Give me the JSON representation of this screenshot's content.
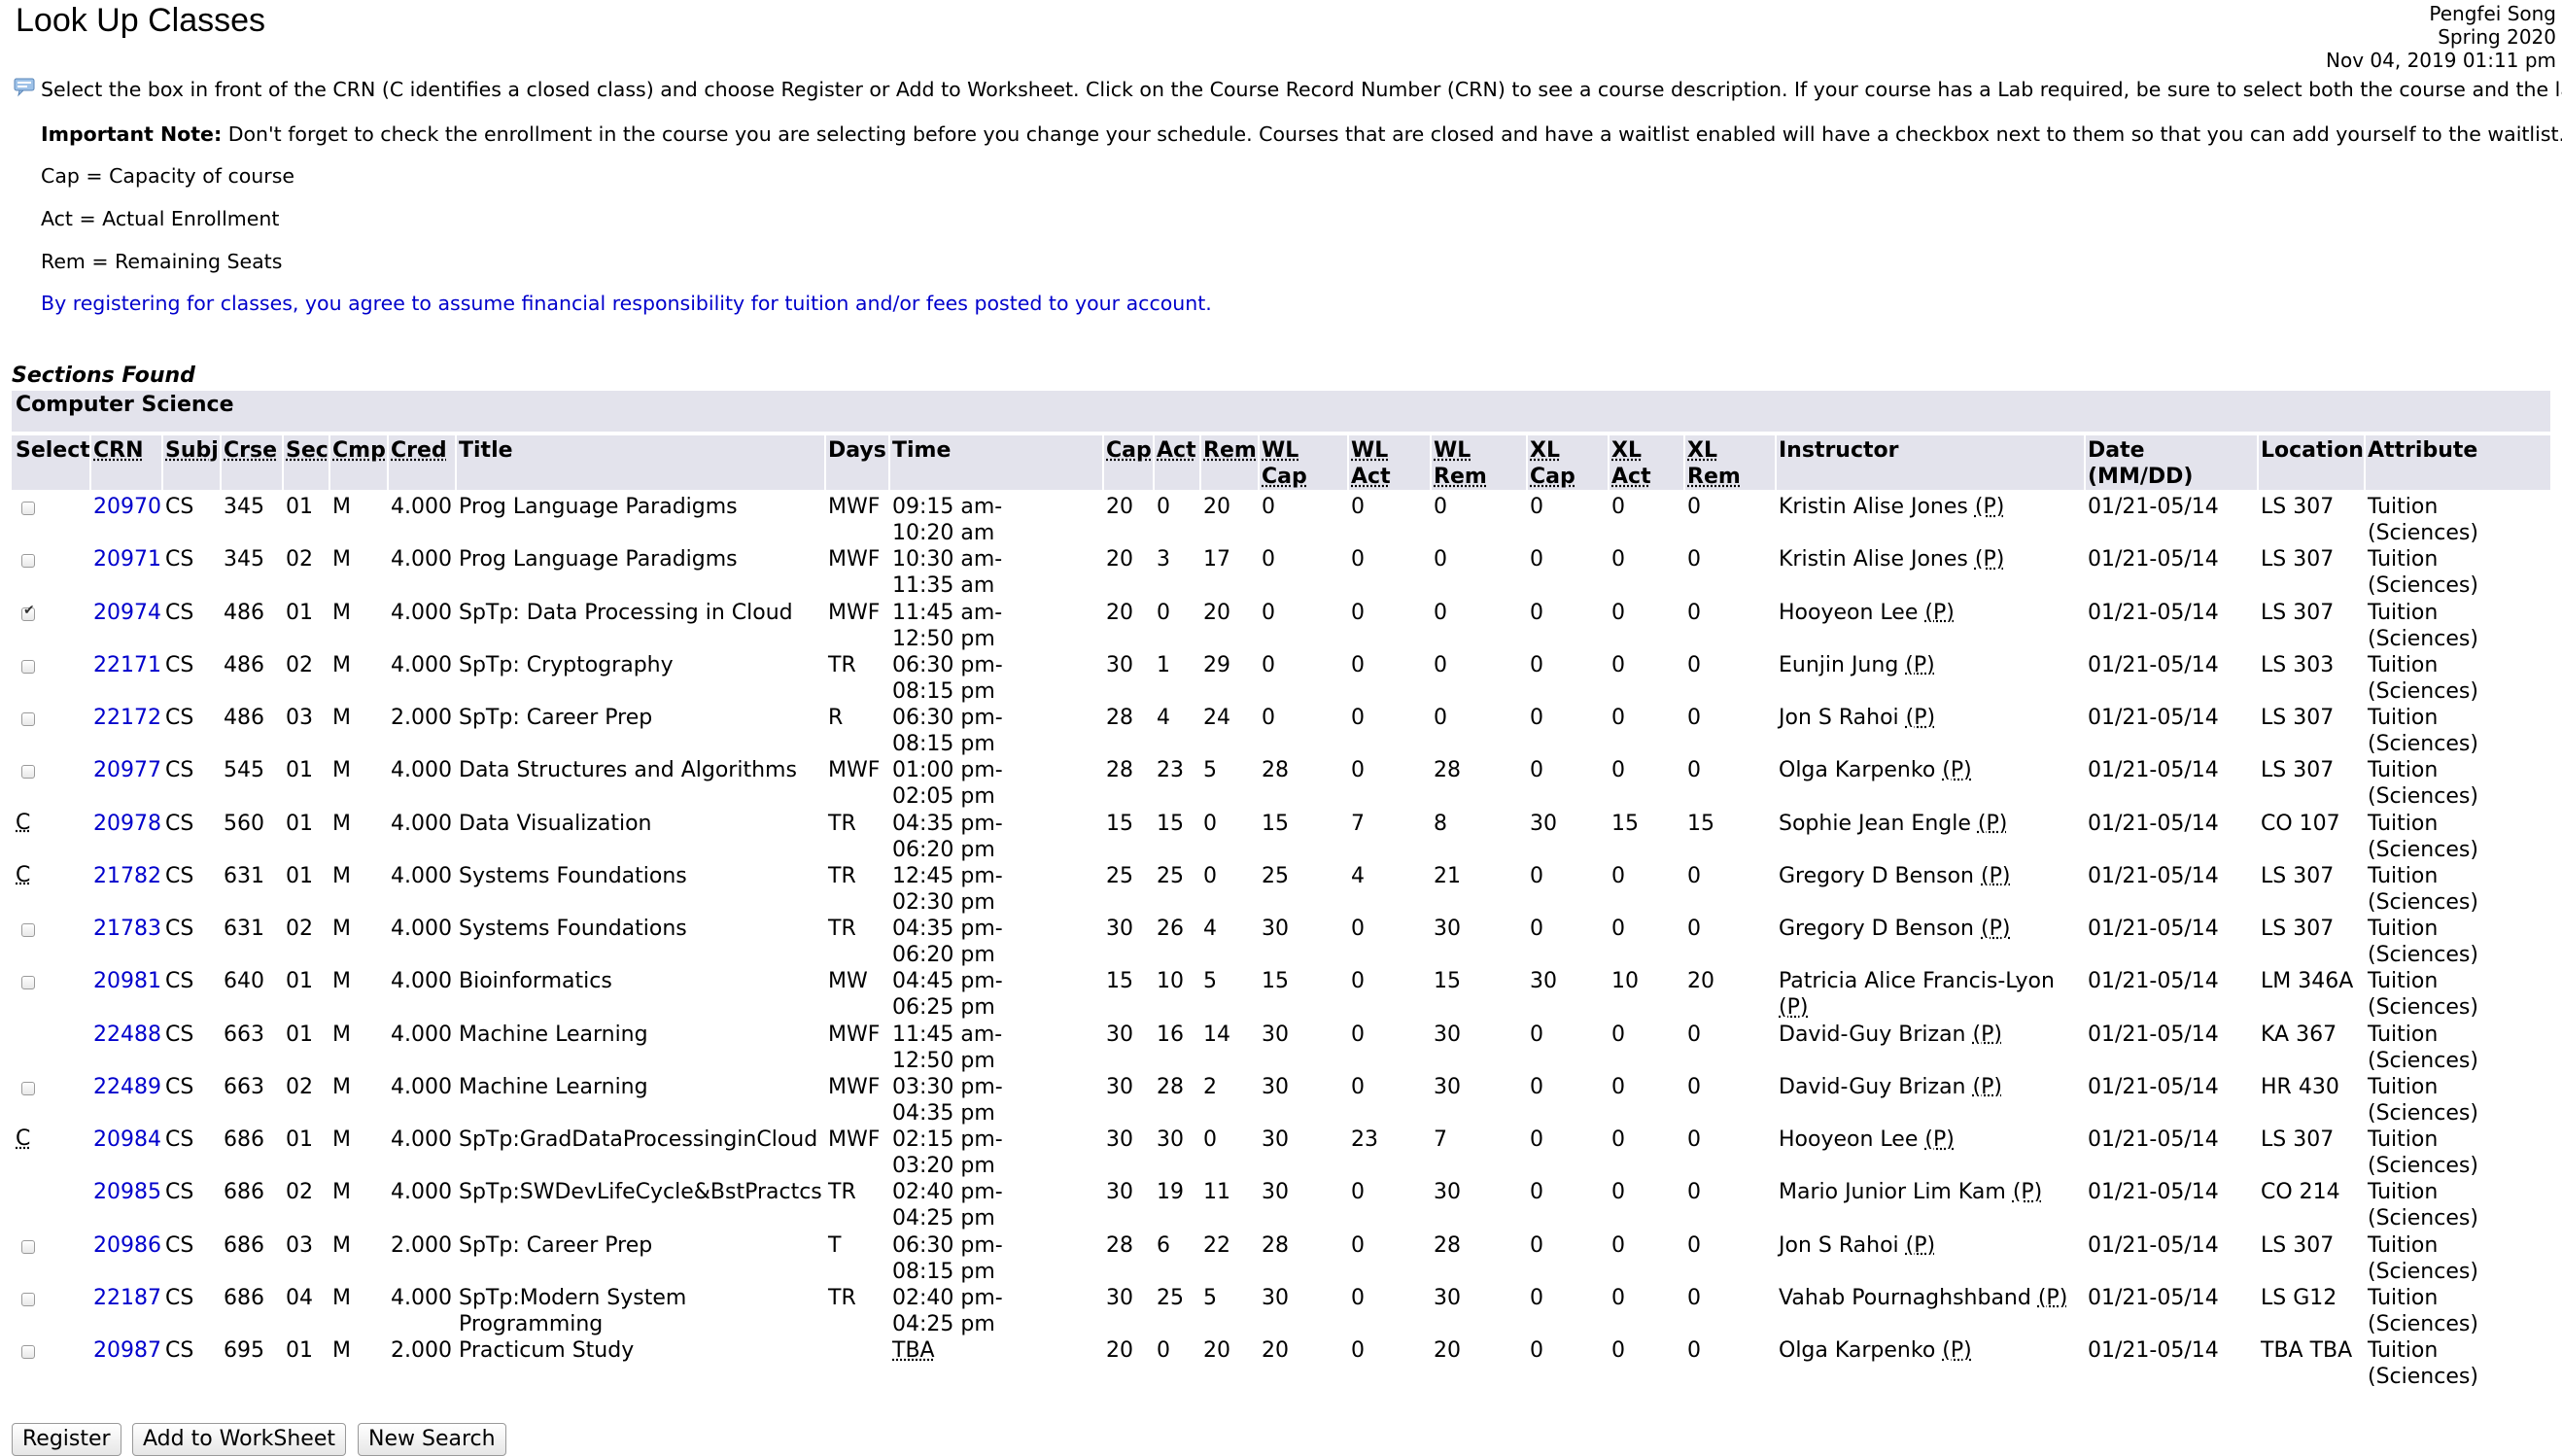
{
  "page": {
    "title": "Look Up Classes",
    "user": "Pengfei Song",
    "term": "Spring 2020",
    "datetime": "Nov 04, 2019 01:11 pm"
  },
  "notes": {
    "instructions": "Select the box in front of the CRN (C identifies a closed class) and choose Register or Add to Worksheet. Click on the Course Record Number (CRN) to see a course description. If your course has a Lab required, be sure to select both the course and the lab.",
    "important_label": "Important Note:",
    "important_text": " Don't forget to check the enrollment in the course you are selecting before you change your schedule. Courses that are closed and have a waitlist enabled will have a checkbox next to them so that you can add yourself to the waitlist.",
    "cap_def": "Cap = Capacity of course",
    "act_def": "Act = Actual Enrollment",
    "rem_def": "Rem = Remaining Seats",
    "financial": "By registering for classes, you agree to assume financial responsibility for tuition and/or fees posted to your account."
  },
  "sections_found": "Sections Found",
  "department": "Computer Science",
  "headers": {
    "select": "Select",
    "crn": "CRN",
    "subj": "Subj",
    "crse": "Crse",
    "sec": "Sec",
    "cmp": "Cmp",
    "cred": "Cred",
    "title": "Title",
    "days": "Days",
    "time": "Time",
    "cap": "Cap",
    "act": "Act",
    "rem": "Rem",
    "wl_cap": "WL\nCap",
    "wl_act": "WL\nAct",
    "wl_rem": "WL\nRem",
    "xl_cap": "XL\nCap",
    "xl_act": "XL\nAct",
    "xl_rem": "XL\nRem",
    "instructor": "Instructor",
    "date": "Date\n(MM/DD)",
    "location": "Location",
    "attribute": "Attribute"
  },
  "rows": [
    {
      "select": "box",
      "crn": "20970",
      "subj": "CS",
      "crse": "345",
      "sec": "01",
      "cmp": "M",
      "cred": "4.000",
      "title": "Prog Language Paradigms",
      "days": "MWF",
      "time": "09:15 am-10:20 am",
      "cap": "20",
      "act": "0",
      "rem": "20",
      "wl_cap": "0",
      "wl_act": "0",
      "wl_rem": "0",
      "xl_cap": "0",
      "xl_act": "0",
      "xl_rem": "0",
      "instructor": "Kristin Alise Jones",
      "date": "01/21-05/14",
      "location": "LS 307",
      "attribute": "Tuition (Sciences)"
    },
    {
      "select": "box",
      "crn": "20971",
      "subj": "CS",
      "crse": "345",
      "sec": "02",
      "cmp": "M",
      "cred": "4.000",
      "title": "Prog Language Paradigms",
      "days": "MWF",
      "time": "10:30 am-11:35 am",
      "cap": "20",
      "act": "3",
      "rem": "17",
      "wl_cap": "0",
      "wl_act": "0",
      "wl_rem": "0",
      "xl_cap": "0",
      "xl_act": "0",
      "xl_rem": "0",
      "instructor": "Kristin Alise Jones",
      "date": "01/21-05/14",
      "location": "LS 307",
      "attribute": "Tuition (Sciences)"
    },
    {
      "select": "checked",
      "crn": "20974",
      "subj": "CS",
      "crse": "486",
      "sec": "01",
      "cmp": "M",
      "cred": "4.000",
      "title": "SpTp: Data Processing in Cloud",
      "days": "MWF",
      "time": "11:45 am-12:50 pm",
      "cap": "20",
      "act": "0",
      "rem": "20",
      "wl_cap": "0",
      "wl_act": "0",
      "wl_rem": "0",
      "xl_cap": "0",
      "xl_act": "0",
      "xl_rem": "0",
      "instructor": "Hooyeon Lee",
      "date": "01/21-05/14",
      "location": "LS 307",
      "attribute": "Tuition (Sciences)"
    },
    {
      "select": "box",
      "crn": "22171",
      "subj": "CS",
      "crse": "486",
      "sec": "02",
      "cmp": "M",
      "cred": "4.000",
      "title": "SpTp: Cryptography",
      "days": "TR",
      "time": "06:30 pm-08:15 pm",
      "cap": "30",
      "act": "1",
      "rem": "29",
      "wl_cap": "0",
      "wl_act": "0",
      "wl_rem": "0",
      "xl_cap": "0",
      "xl_act": "0",
      "xl_rem": "0",
      "instructor": "Eunjin Jung",
      "date": "01/21-05/14",
      "location": "LS 303",
      "attribute": "Tuition (Sciences)"
    },
    {
      "select": "box",
      "crn": "22172",
      "subj": "CS",
      "crse": "486",
      "sec": "03",
      "cmp": "M",
      "cred": "2.000",
      "title": "SpTp: Career Prep",
      "days": "R",
      "time": "06:30 pm-08:15 pm",
      "cap": "28",
      "act": "4",
      "rem": "24",
      "wl_cap": "0",
      "wl_act": "0",
      "wl_rem": "0",
      "xl_cap": "0",
      "xl_act": "0",
      "xl_rem": "0",
      "instructor": "Jon S Rahoi",
      "date": "01/21-05/14",
      "location": "LS 307",
      "attribute": "Tuition (Sciences)"
    },
    {
      "select": "box",
      "crn": "20977",
      "subj": "CS",
      "crse": "545",
      "sec": "01",
      "cmp": "M",
      "cred": "4.000",
      "title": "Data Structures and Algorithms",
      "days": "MWF",
      "time": "01:00 pm-02:05 pm",
      "cap": "28",
      "act": "23",
      "rem": "5",
      "wl_cap": "28",
      "wl_act": "0",
      "wl_rem": "28",
      "xl_cap": "0",
      "xl_act": "0",
      "xl_rem": "0",
      "instructor": "Olga Karpenko",
      "date": "01/21-05/14",
      "location": "LS 307",
      "attribute": "Tuition (Sciences)"
    },
    {
      "select": "C",
      "crn": "20978",
      "subj": "CS",
      "crse": "560",
      "sec": "01",
      "cmp": "M",
      "cred": "4.000",
      "title": "Data Visualization",
      "days": "TR",
      "time": "04:35 pm-06:20 pm",
      "cap": "15",
      "act": "15",
      "rem": "0",
      "wl_cap": "15",
      "wl_act": "7",
      "wl_rem": "8",
      "xl_cap": "30",
      "xl_act": "15",
      "xl_rem": "15",
      "instructor": "Sophie Jean Engle",
      "date": "01/21-05/14",
      "location": "CO 107",
      "attribute": "Tuition (Sciences)"
    },
    {
      "select": "C",
      "crn": "21782",
      "subj": "CS",
      "crse": "631",
      "sec": "01",
      "cmp": "M",
      "cred": "4.000",
      "title": "Systems Foundations",
      "days": "TR",
      "time": "12:45 pm-02:30 pm",
      "cap": "25",
      "act": "25",
      "rem": "0",
      "wl_cap": "25",
      "wl_act": "4",
      "wl_rem": "21",
      "xl_cap": "0",
      "xl_act": "0",
      "xl_rem": "0",
      "instructor": "Gregory D Benson",
      "date": "01/21-05/14",
      "location": "LS 307",
      "attribute": "Tuition (Sciences)"
    },
    {
      "select": "box",
      "crn": "21783",
      "subj": "CS",
      "crse": "631",
      "sec": "02",
      "cmp": "M",
      "cred": "4.000",
      "title": "Systems Foundations",
      "days": "TR",
      "time": "04:35 pm-06:20 pm",
      "cap": "30",
      "act": "26",
      "rem": "4",
      "wl_cap": "30",
      "wl_act": "0",
      "wl_rem": "30",
      "xl_cap": "0",
      "xl_act": "0",
      "xl_rem": "0",
      "instructor": "Gregory D Benson",
      "date": "01/21-05/14",
      "location": "LS 307",
      "attribute": "Tuition (Sciences)"
    },
    {
      "select": "box",
      "crn": "20981",
      "subj": "CS",
      "crse": "640",
      "sec": "01",
      "cmp": "M",
      "cred": "4.000",
      "title": "Bioinformatics",
      "days": "MW",
      "time": "04:45 pm-06:25 pm",
      "cap": "15",
      "act": "10",
      "rem": "5",
      "wl_cap": "15",
      "wl_act": "0",
      "wl_rem": "15",
      "xl_cap": "30",
      "xl_act": "10",
      "xl_rem": "20",
      "instructor": "Patricia Alice Francis-Lyon",
      "date": "01/21-05/14",
      "location": "LM 346A",
      "attribute": "Tuition (Sciences)"
    },
    {
      "select": "",
      "crn": "22488",
      "subj": "CS",
      "crse": "663",
      "sec": "01",
      "cmp": "M",
      "cred": "4.000",
      "title": "Machine Learning",
      "days": "MWF",
      "time": "11:45 am-12:50 pm",
      "cap": "30",
      "act": "16",
      "rem": "14",
      "wl_cap": "30",
      "wl_act": "0",
      "wl_rem": "30",
      "xl_cap": "0",
      "xl_act": "0",
      "xl_rem": "0",
      "instructor": "David-Guy Brizan",
      "date": "01/21-05/14",
      "location": "KA 367",
      "attribute": "Tuition (Sciences)"
    },
    {
      "select": "box",
      "crn": "22489",
      "subj": "CS",
      "crse": "663",
      "sec": "02",
      "cmp": "M",
      "cred": "4.000",
      "title": "Machine Learning",
      "days": "MWF",
      "time": "03:30 pm-04:35 pm",
      "cap": "30",
      "act": "28",
      "rem": "2",
      "wl_cap": "30",
      "wl_act": "0",
      "wl_rem": "30",
      "xl_cap": "0",
      "xl_act": "0",
      "xl_rem": "0",
      "instructor": "David-Guy Brizan",
      "date": "01/21-05/14",
      "location": "HR 430",
      "attribute": "Tuition (Sciences)"
    },
    {
      "select": "C",
      "crn": "20984",
      "subj": "CS",
      "crse": "686",
      "sec": "01",
      "cmp": "M",
      "cred": "4.000",
      "title": "SpTp:GradDataProcessinginCloud",
      "days": "MWF",
      "time": "02:15 pm-03:20 pm",
      "cap": "30",
      "act": "30",
      "rem": "0",
      "wl_cap": "30",
      "wl_act": "23",
      "wl_rem": "7",
      "xl_cap": "0",
      "xl_act": "0",
      "xl_rem": "0",
      "instructor": "Hooyeon Lee",
      "date": "01/21-05/14",
      "location": "LS 307",
      "attribute": "Tuition (Sciences)"
    },
    {
      "select": "",
      "crn": "20985",
      "subj": "CS",
      "crse": "686",
      "sec": "02",
      "cmp": "M",
      "cred": "4.000",
      "title": "SpTp:SWDevLifeCycle&BstPractcs",
      "days": "TR",
      "time": "02:40 pm-04:25 pm",
      "cap": "30",
      "act": "19",
      "rem": "11",
      "wl_cap": "30",
      "wl_act": "0",
      "wl_rem": "30",
      "xl_cap": "0",
      "xl_act": "0",
      "xl_rem": "0",
      "instructor": "Mario Junior Lim Kam",
      "date": "01/21-05/14",
      "location": "CO 214",
      "attribute": "Tuition (Sciences)"
    },
    {
      "select": "box",
      "crn": "20986",
      "subj": "CS",
      "crse": "686",
      "sec": "03",
      "cmp": "M",
      "cred": "2.000",
      "title": "SpTp: Career Prep",
      "days": "T",
      "time": "06:30 pm-08:15 pm",
      "cap": "28",
      "act": "6",
      "rem": "22",
      "wl_cap": "28",
      "wl_act": "0",
      "wl_rem": "28",
      "xl_cap": "0",
      "xl_act": "0",
      "xl_rem": "0",
      "instructor": "Jon S Rahoi",
      "date": "01/21-05/14",
      "location": "LS 307",
      "attribute": "Tuition (Sciences)"
    },
    {
      "select": "box",
      "crn": "22187",
      "subj": "CS",
      "crse": "686",
      "sec": "04",
      "cmp": "M",
      "cred": "4.000",
      "title": "SpTp:Modern System Programming",
      "days": "TR",
      "time": "02:40 pm-04:25 pm",
      "cap": "30",
      "act": "25",
      "rem": "5",
      "wl_cap": "30",
      "wl_act": "0",
      "wl_rem": "30",
      "xl_cap": "0",
      "xl_act": "0",
      "xl_rem": "0",
      "instructor": "Vahab Pournaghshband",
      "date": "01/21-05/14",
      "location": "LS G12",
      "attribute": "Tuition (Sciences)"
    },
    {
      "select": "box",
      "crn": "20987",
      "subj": "CS",
      "crse": "695",
      "sec": "01",
      "cmp": "M",
      "cred": "2.000",
      "title": "Practicum Study",
      "days": "",
      "time": "TBA",
      "cap": "20",
      "act": "0",
      "rem": "20",
      "wl_cap": "20",
      "wl_act": "0",
      "wl_rem": "20",
      "xl_cap": "0",
      "xl_act": "0",
      "xl_rem": "0",
      "instructor": "Olga Karpenko",
      "date": "01/21-05/14",
      "location": "TBA TBA",
      "attribute": "Tuition (Sciences)"
    }
  ],
  "instructor_suffix": "(P)",
  "buttons": {
    "register": "Register",
    "add_worksheet": "Add to WorkSheet",
    "new_search": "New Search"
  }
}
